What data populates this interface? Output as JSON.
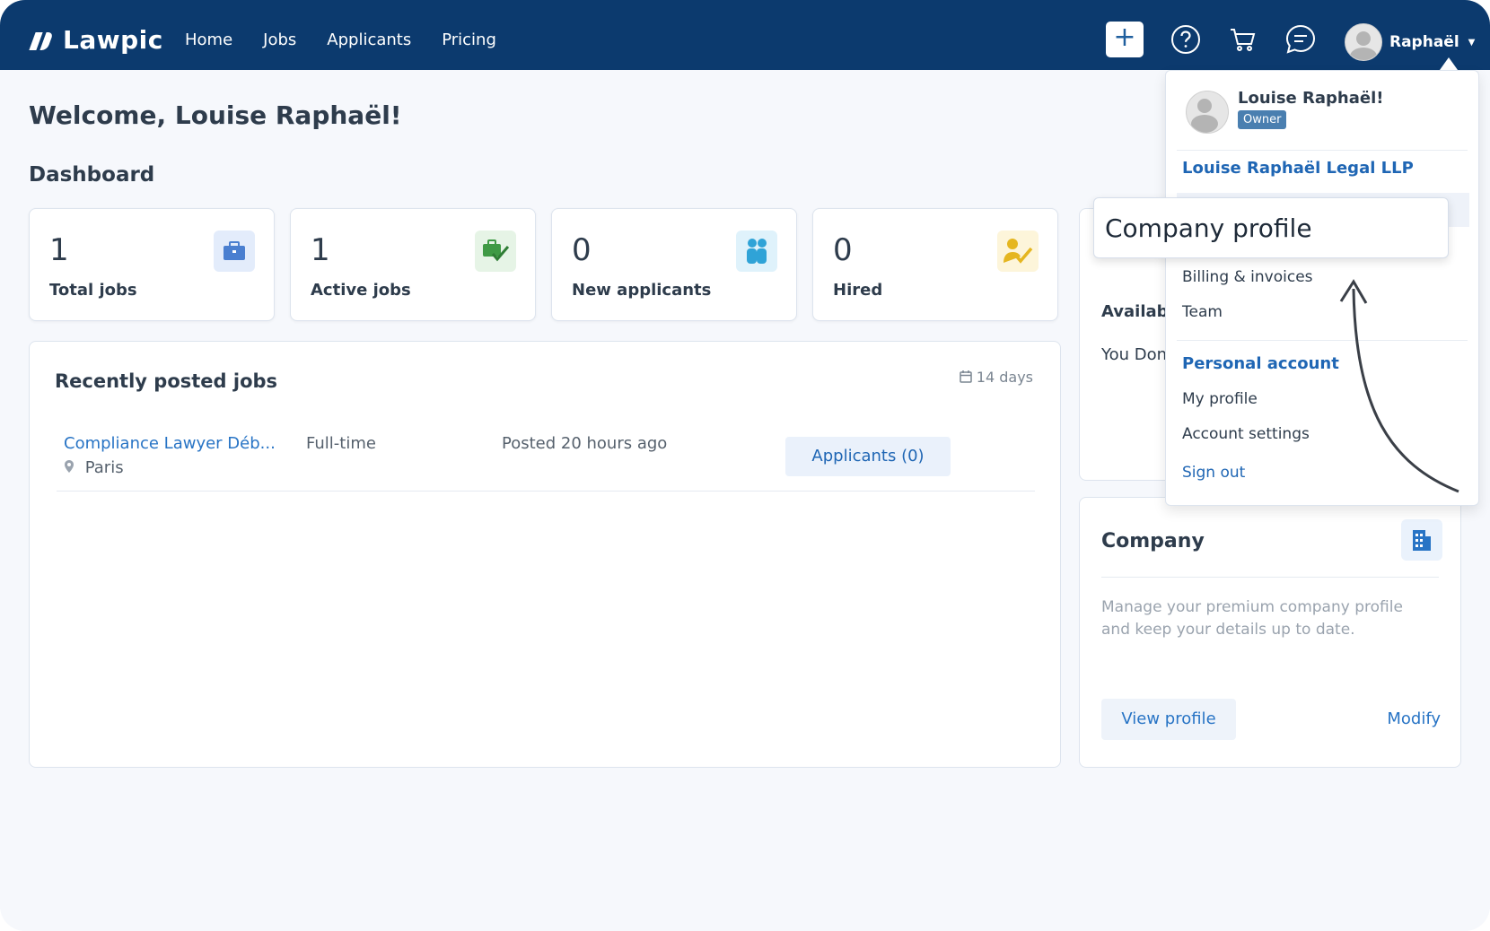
{
  "nav": {
    "brand": "Lawpic",
    "links": [
      "Home",
      "Jobs",
      "Applicants",
      "Pricing"
    ],
    "user_name": "Raphaël",
    "add_label": "+"
  },
  "welcome": "Welcome, Louise Raphaël!",
  "dashboard_title": "Dashboard",
  "stats": [
    {
      "value": "1",
      "label": "Total jobs",
      "icon": "briefcase-icon",
      "icon_bg": "#e3ecfb",
      "icon_color": "#4a7fd0"
    },
    {
      "value": "1",
      "label": "Active jobs",
      "icon": "briefcase-check-icon",
      "icon_bg": "#e6f4e6",
      "icon_color": "#3f9a45"
    },
    {
      "value": "0",
      "label": "New applicants",
      "icon": "people-icon",
      "icon_bg": "#dff2fb",
      "icon_color": "#2fa3d7"
    },
    {
      "value": "0",
      "label": "Hired",
      "icon": "person-check-icon",
      "icon_bg": "#fdf5da",
      "icon_color": "#e5b620"
    }
  ],
  "recent_jobs": {
    "title": "Recently posted jobs",
    "range": "14 days",
    "rows": [
      {
        "title": "Compliance Lawyer Déb...",
        "location": "Paris",
        "type": "Full-time",
        "posted": "Posted 20 hours ago",
        "applicants_label": "Applicants  (0)"
      }
    ]
  },
  "right_panel": {
    "available_label": "Availabl",
    "you_label": "You Don"
  },
  "company_card": {
    "title": "Company",
    "description": "Manage your premium company profile and keep your details up to date.",
    "view_label": "View profile",
    "modify_label": "Modify"
  },
  "dropdown": {
    "user_name": "Louise Raphaël!",
    "role": "Owner",
    "company_name": "Louise Raphaël Legal LLP",
    "billing": "Billing & invoices",
    "team": "Team",
    "personal_header": "Personal account",
    "my_profile": "My profile",
    "account_settings": "Account settings",
    "sign_out": "Sign out"
  },
  "callout": "Company profile",
  "colors": {
    "nav_bg": "#0c3a6e",
    "link_blue": "#2874c5",
    "accent_blue": "#1f66b4"
  }
}
